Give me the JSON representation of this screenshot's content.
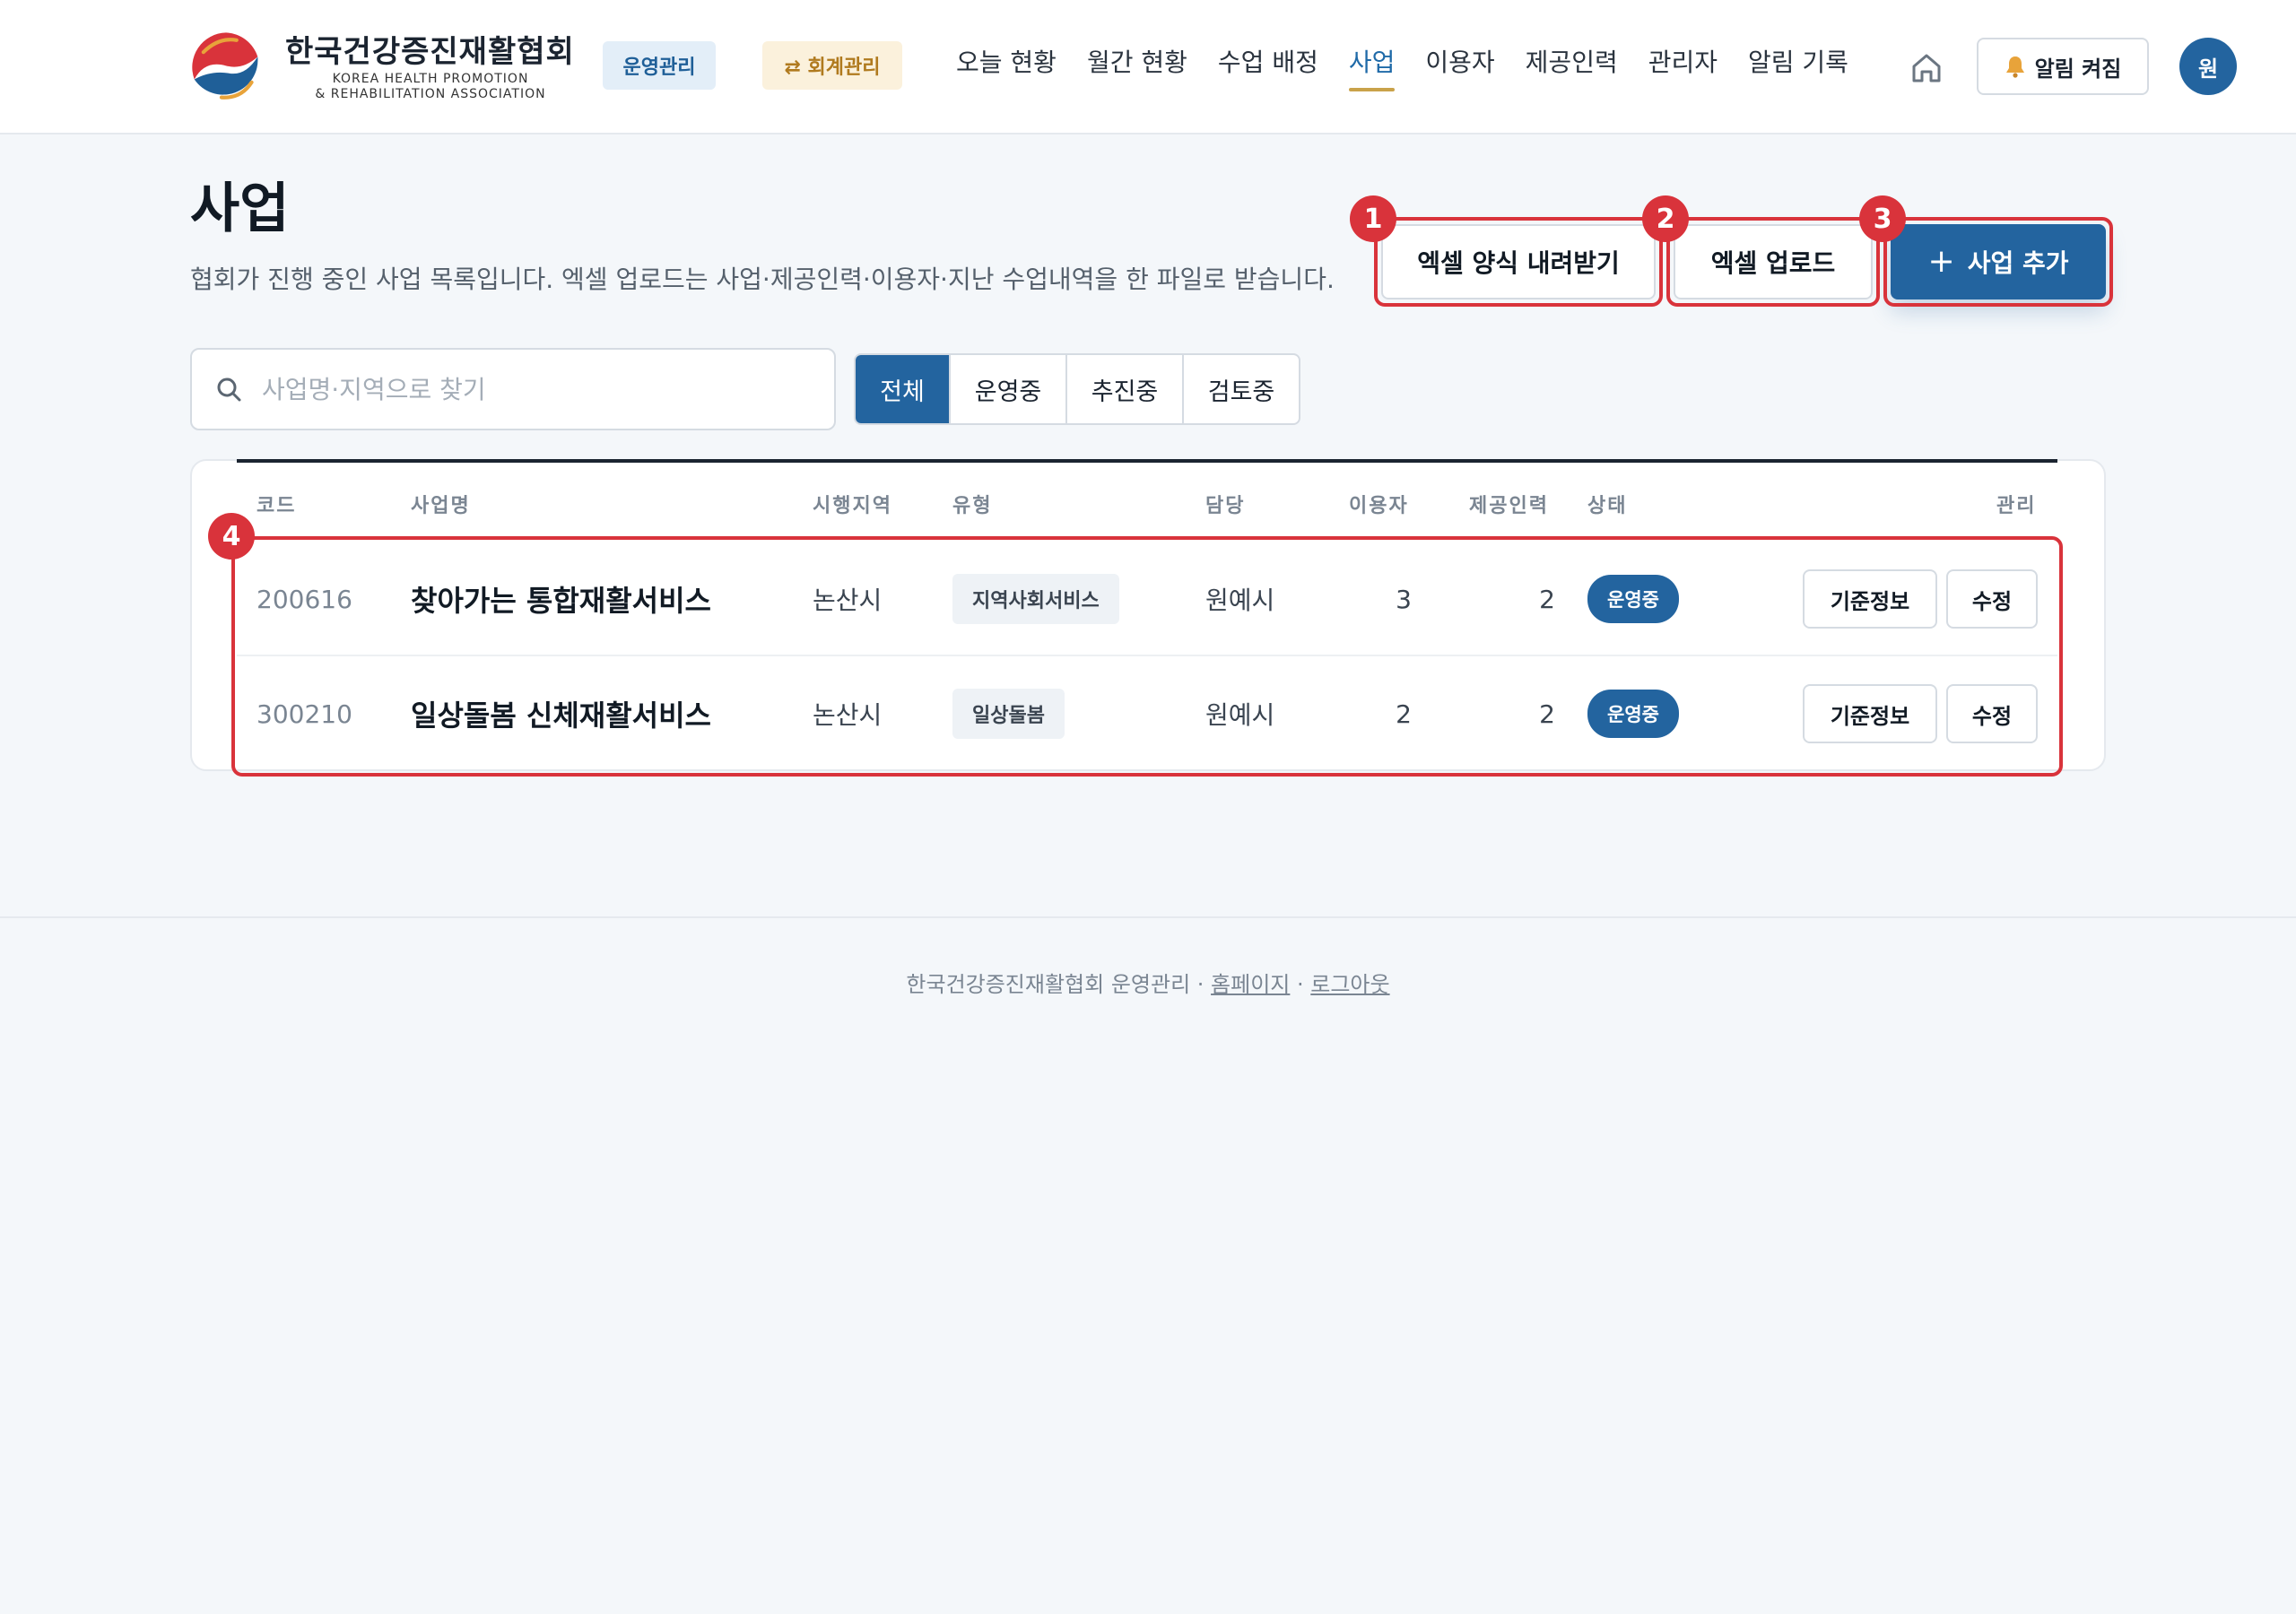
{
  "header": {
    "org_name_ko": "한국건강증진재활협회",
    "org_name_en_1": "KOREA HEALTH PROMOTION",
    "org_name_en_2": "& REHABILITATION ASSOCIATION",
    "mode_ops": "운영관리",
    "mode_accounting": "⇄ 회계관리",
    "nav": [
      {
        "label": "오늘 현황"
      },
      {
        "label": "월간 현황"
      },
      {
        "label": "수업 배정"
      },
      {
        "label": "사업",
        "active": true
      },
      {
        "label": "이용자"
      },
      {
        "label": "제공인력"
      },
      {
        "label": "관리자"
      },
      {
        "label": "알림 기록"
      }
    ],
    "alert_label": "알림 켜짐",
    "avatar_initial": "원"
  },
  "page": {
    "title": "사업",
    "description": "협회가 진행 중인 사업 목록입니다. 엑셀 업로드는 사업·제공인력·이용자·지난 수업내역을 한 파일로 받습니다."
  },
  "actions": {
    "download_template": "엑셀 양식 내려받기",
    "upload": "엑셀 업로드",
    "add_plus": "+",
    "add": "사업 추가"
  },
  "badges": [
    "1",
    "2",
    "3",
    "4"
  ],
  "search": {
    "placeholder": "사업명·지역으로 찾기",
    "value": ""
  },
  "filters": [
    {
      "label": "전체",
      "active": true
    },
    {
      "label": "운영중"
    },
    {
      "label": "추진중"
    },
    {
      "label": "검토중"
    }
  ],
  "table": {
    "columns": [
      "코드",
      "사업명",
      "시행지역",
      "유형",
      "담당",
      "이용자",
      "제공인력",
      "상태",
      "관리"
    ],
    "rows": [
      {
        "code": "200616",
        "name": "찾아가는 통합재활서비스",
        "region": "논산시",
        "type": "지역사회서비스",
        "owner": "원예시",
        "users": "3",
        "staff": "2",
        "status": "운영중",
        "info_btn": "기준정보",
        "edit_btn": "수정"
      },
      {
        "code": "300210",
        "name": "일상돌봄 신체재활서비스",
        "region": "논산시",
        "type": "일상돌봄",
        "owner": "원예시",
        "users": "2",
        "staff": "2",
        "status": "운영중",
        "info_btn": "기준정보",
        "edit_btn": "수정"
      }
    ]
  },
  "footer": {
    "text": "한국건강증진재활협회 운영관리 · ",
    "homepage": "홈페이지",
    "sep": " · ",
    "logout": "로그아웃"
  },
  "colors": {
    "primary": "#23649f",
    "highlight": "#d9333b",
    "nav_underline": "#c9a24a",
    "accounting_text": "#b07a1e"
  },
  "icons": {
    "logo": "taegeuk-logo",
    "home": "home-icon",
    "bell": "bell-icon",
    "search": "search-icon"
  }
}
